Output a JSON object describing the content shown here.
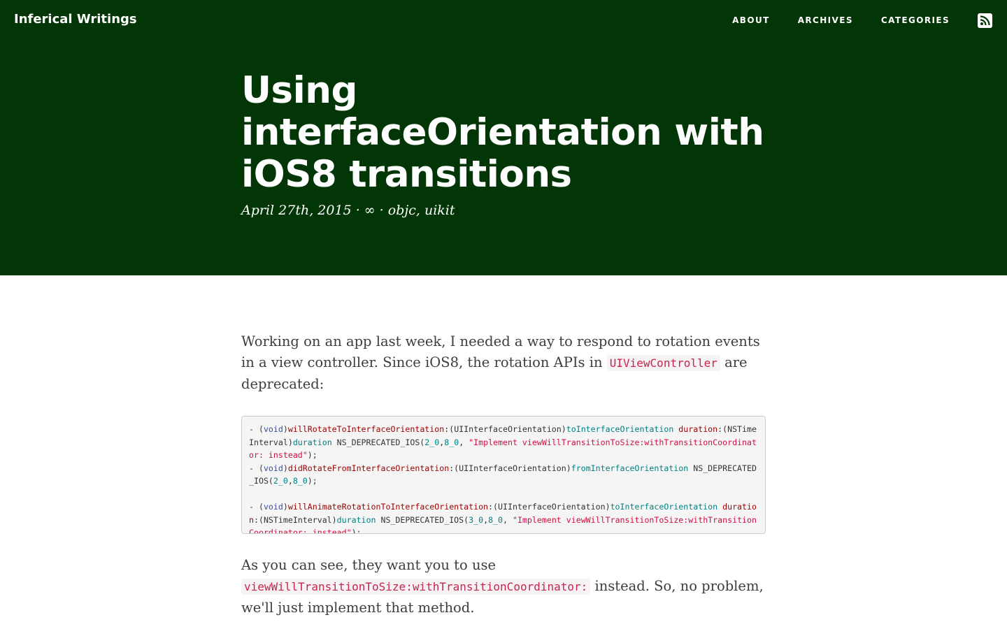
{
  "site": {
    "brand": "Inferical Writings",
    "nav": [
      "ABOUT",
      "ARCHIVES",
      "CATEGORIES"
    ]
  },
  "post": {
    "title": "Using interfaceOrientation with iOS8 transitions",
    "date": "April 27th, 2015",
    "separator": "·",
    "permalink": "∞",
    "categories": "objc, uikit"
  },
  "body": {
    "p1_before": "Working on an app last week, I needed a way to respond to rotation events in a view controller. Since iOS8, the rotation APIs in ",
    "p1_code": "UIViewController",
    "p1_after": " are deprecated:",
    "p2_before": "As you can see, they want you to use ",
    "p2_code": "viewWillTransitionToSize:withTransitionCoordinator:",
    "p2_after": " instead. So, no problem, we'll just implement that method."
  },
  "code": {
    "line1": {
      "dash": "- (",
      "void": "void",
      "close": ")",
      "sel": "willRotateToInterfaceOrientation",
      "colon": ":(UIInterfaceOrientation)",
      "arg": "toInterfaceOrientation",
      "lbl": " duration",
      "colon2": ":(NSTimeInterval)",
      "arg2": "duration",
      "macro": " NS_DEPRECATED_IOS(",
      "n1": "2_0",
      "comma": ",",
      "n2": "8_0",
      "comma2": ", ",
      "str": "\"Implement viewWillTransitionToSize:withTransitionCoordinator: instead\"",
      "end": ");"
    },
    "line2": {
      "dash": "- (",
      "void": "void",
      "close": ")",
      "sel": "didRotateFromInterfaceOrientation",
      "colon": ":(UIInterfaceOrientation)",
      "arg": "fromInterfaceOrientation",
      "macro": " NS_DEPRECATED_IOS(",
      "n1": "2_0",
      "comma": ",",
      "n2": "8_0",
      "end": ");"
    },
    "line3": {
      "dash": "- (",
      "void": "void",
      "close": ")",
      "sel": "willAnimateRotationToInterfaceOrientation",
      "colon": ":(UIInterfaceOrientation)",
      "arg": "toInterfaceOrientation",
      "lbl": " duration",
      "colon2": ":(NSTimeInterval)",
      "arg2": "duration",
      "macro": " NS_DEPRECATED_IOS(",
      "n1": "3_0",
      "comma": ",",
      "n2": "8_0",
      "comma2": ", ",
      "str": "\"Implement viewWillTransitionToSize:withTransitionCoordinator: instead\"",
      "end": ");"
    }
  },
  "icons": {
    "rss": "rss-icon"
  },
  "colors": {
    "hero_bg": "#033606",
    "inline_code": "#c7254e"
  }
}
